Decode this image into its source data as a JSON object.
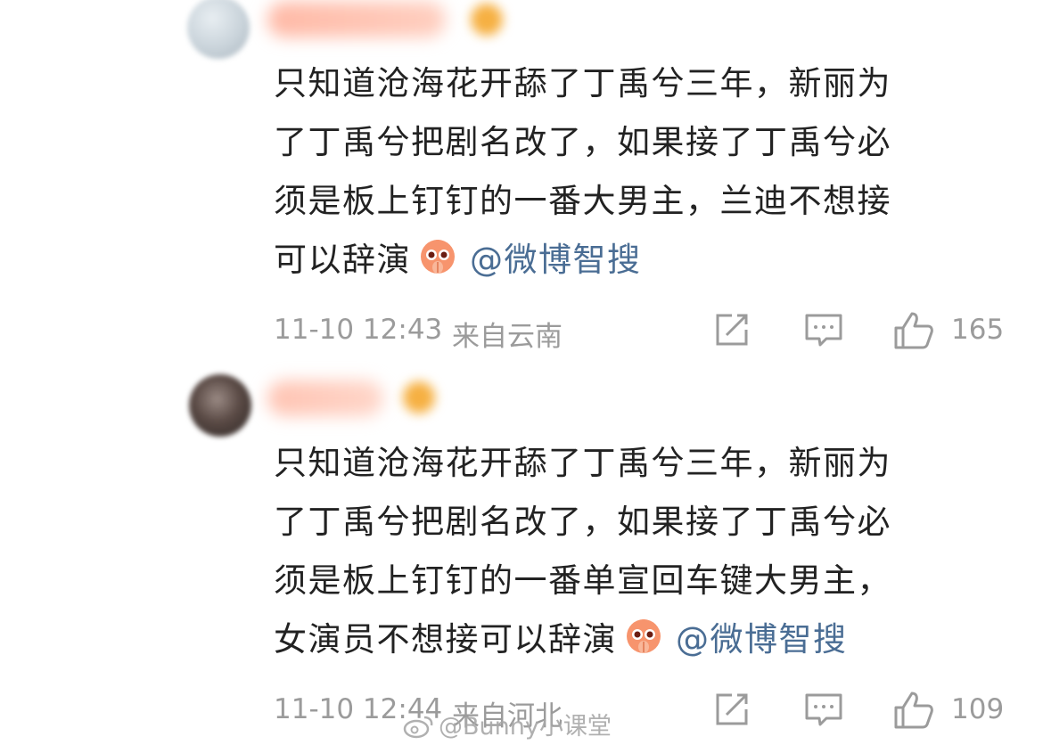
{
  "comments": [
    {
      "lines": [
        "只知道沧海花开舔了丁禹兮三年，新丽为",
        "了丁禹兮把剧名改了，如果接了丁禹兮必",
        "须是板上钉钉的一番大男主，兰迪不想接"
      ],
      "last_line_text": "可以辞演",
      "mention": "@微博智搜",
      "time": "11-10 12:43",
      "location": "来自云南",
      "like_count": "165"
    },
    {
      "lines": [
        "只知道沧海花开舔了丁禹兮三年，新丽为",
        "了丁禹兮把剧名改了，如果接了丁禹兮必",
        "须是板上钉钉的一番单宣回车键大男主，"
      ],
      "last_line_text": "女演员不想接可以辞演",
      "mention": "@微博智搜",
      "time": "11-10 12:44",
      "location": "来自河北",
      "like_count": "109"
    }
  ],
  "watermark": "@Bunny小课堂",
  "icons": {
    "share": "share-edit-icon",
    "comment": "comment-icon",
    "like": "thumbs-up-icon",
    "emoji": "praying-emoji-icon"
  },
  "colors": {
    "text": "#222222",
    "meta": "#9b9b9b",
    "mention": "#4a6d94"
  }
}
